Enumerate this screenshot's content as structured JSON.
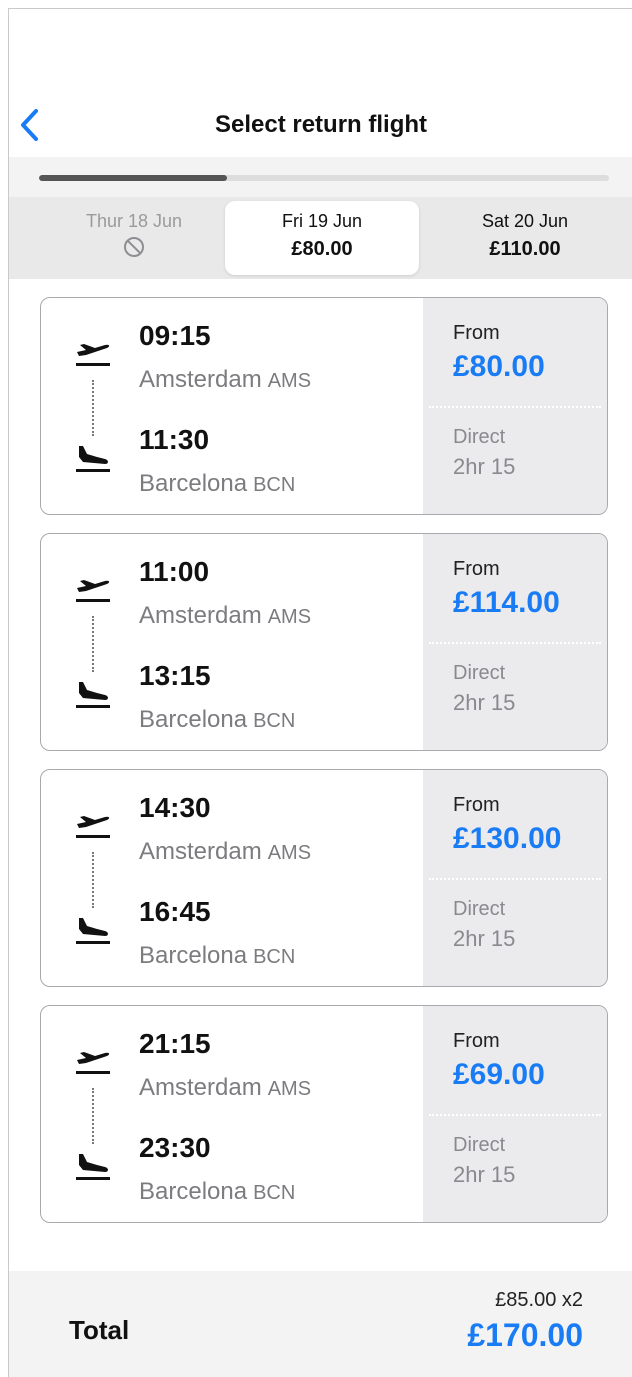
{
  "header": {
    "title": "Select return flight"
  },
  "progress": {
    "fraction": 0.33
  },
  "dates": [
    {
      "label": "Thur 18 Jun",
      "price": "",
      "status": "unavailable"
    },
    {
      "label": "Fri 19 Jun",
      "price": "£80.00",
      "status": "selected"
    },
    {
      "label": "Sat 20 Jun",
      "price": "£110.00",
      "status": "available"
    }
  ],
  "flights": [
    {
      "departure_time": "09:15",
      "departure_city": "Amsterdam",
      "departure_code": "AMS",
      "arrival_time": "11:30",
      "arrival_city": "Barcelona",
      "arrival_code": "BCN",
      "from_label": "From",
      "price": "£80.00",
      "stops": "Direct",
      "duration": "2hr 15"
    },
    {
      "departure_time": "11:00",
      "departure_city": "Amsterdam",
      "departure_code": "AMS",
      "arrival_time": "13:15",
      "arrival_city": "Barcelona",
      "arrival_code": "BCN",
      "from_label": "From",
      "price": "£114.00",
      "stops": "Direct",
      "duration": "2hr 15"
    },
    {
      "departure_time": "14:30",
      "departure_city": "Amsterdam",
      "departure_code": "AMS",
      "arrival_time": "16:45",
      "arrival_city": "Barcelona",
      "arrival_code": "BCN",
      "from_label": "From",
      "price": "£130.00",
      "stops": "Direct",
      "duration": "2hr 15"
    },
    {
      "departure_time": "21:15",
      "departure_city": "Amsterdam",
      "departure_code": "AMS",
      "arrival_time": "23:30",
      "arrival_city": "Barcelona",
      "arrival_code": "BCN",
      "from_label": "From",
      "price": "£69.00",
      "stops": "Direct",
      "duration": "2hr 15"
    }
  ],
  "total": {
    "label": "Total",
    "breakdown": "£85.00 x2",
    "amount": "£170.00"
  },
  "icons": {
    "back": "chevron-left-icon",
    "unavailable": "no-entry-icon",
    "departure": "plane-takeoff-icon",
    "arrival": "plane-landing-icon"
  },
  "colors": {
    "accent": "#1a7cf5",
    "muted": "#8a8a8e",
    "panel": "#ebebed"
  }
}
